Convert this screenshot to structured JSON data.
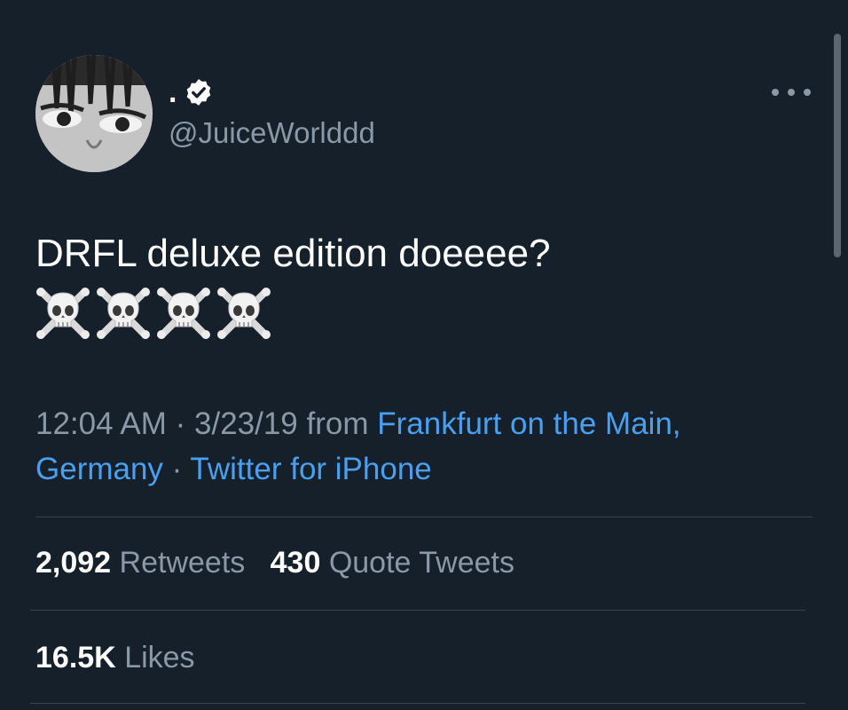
{
  "author": {
    "display_name": ".",
    "handle": "@JuiceWorlddd",
    "verified": true
  },
  "tweet": {
    "text": "DRFL deluxe edition doeeee?",
    "emoji": [
      "☠️",
      "☠️",
      "☠️",
      "☠️"
    ]
  },
  "meta": {
    "time": "12:04 AM",
    "separator": " · ",
    "date": "3/23/19",
    "from_label": "from",
    "location": "Frankfurt on the Main, Germany",
    "source": "Twitter for iPhone"
  },
  "stats": {
    "retweets_count": "2,092",
    "retweets_label": "Retweets",
    "quotes_count": "430",
    "quotes_label": "Quote Tweets",
    "likes_count": "16.5K",
    "likes_label": "Likes"
  },
  "colors": {
    "background": "#15202b",
    "text_primary": "#ffffff",
    "text_secondary": "#8b98a5",
    "link": "#4a9ff0",
    "divider": "#38444d"
  },
  "icons": {
    "verified": "verified-badge-icon",
    "more": "more-horizontal-icon",
    "emoji": "skull-crossbones-icon"
  }
}
